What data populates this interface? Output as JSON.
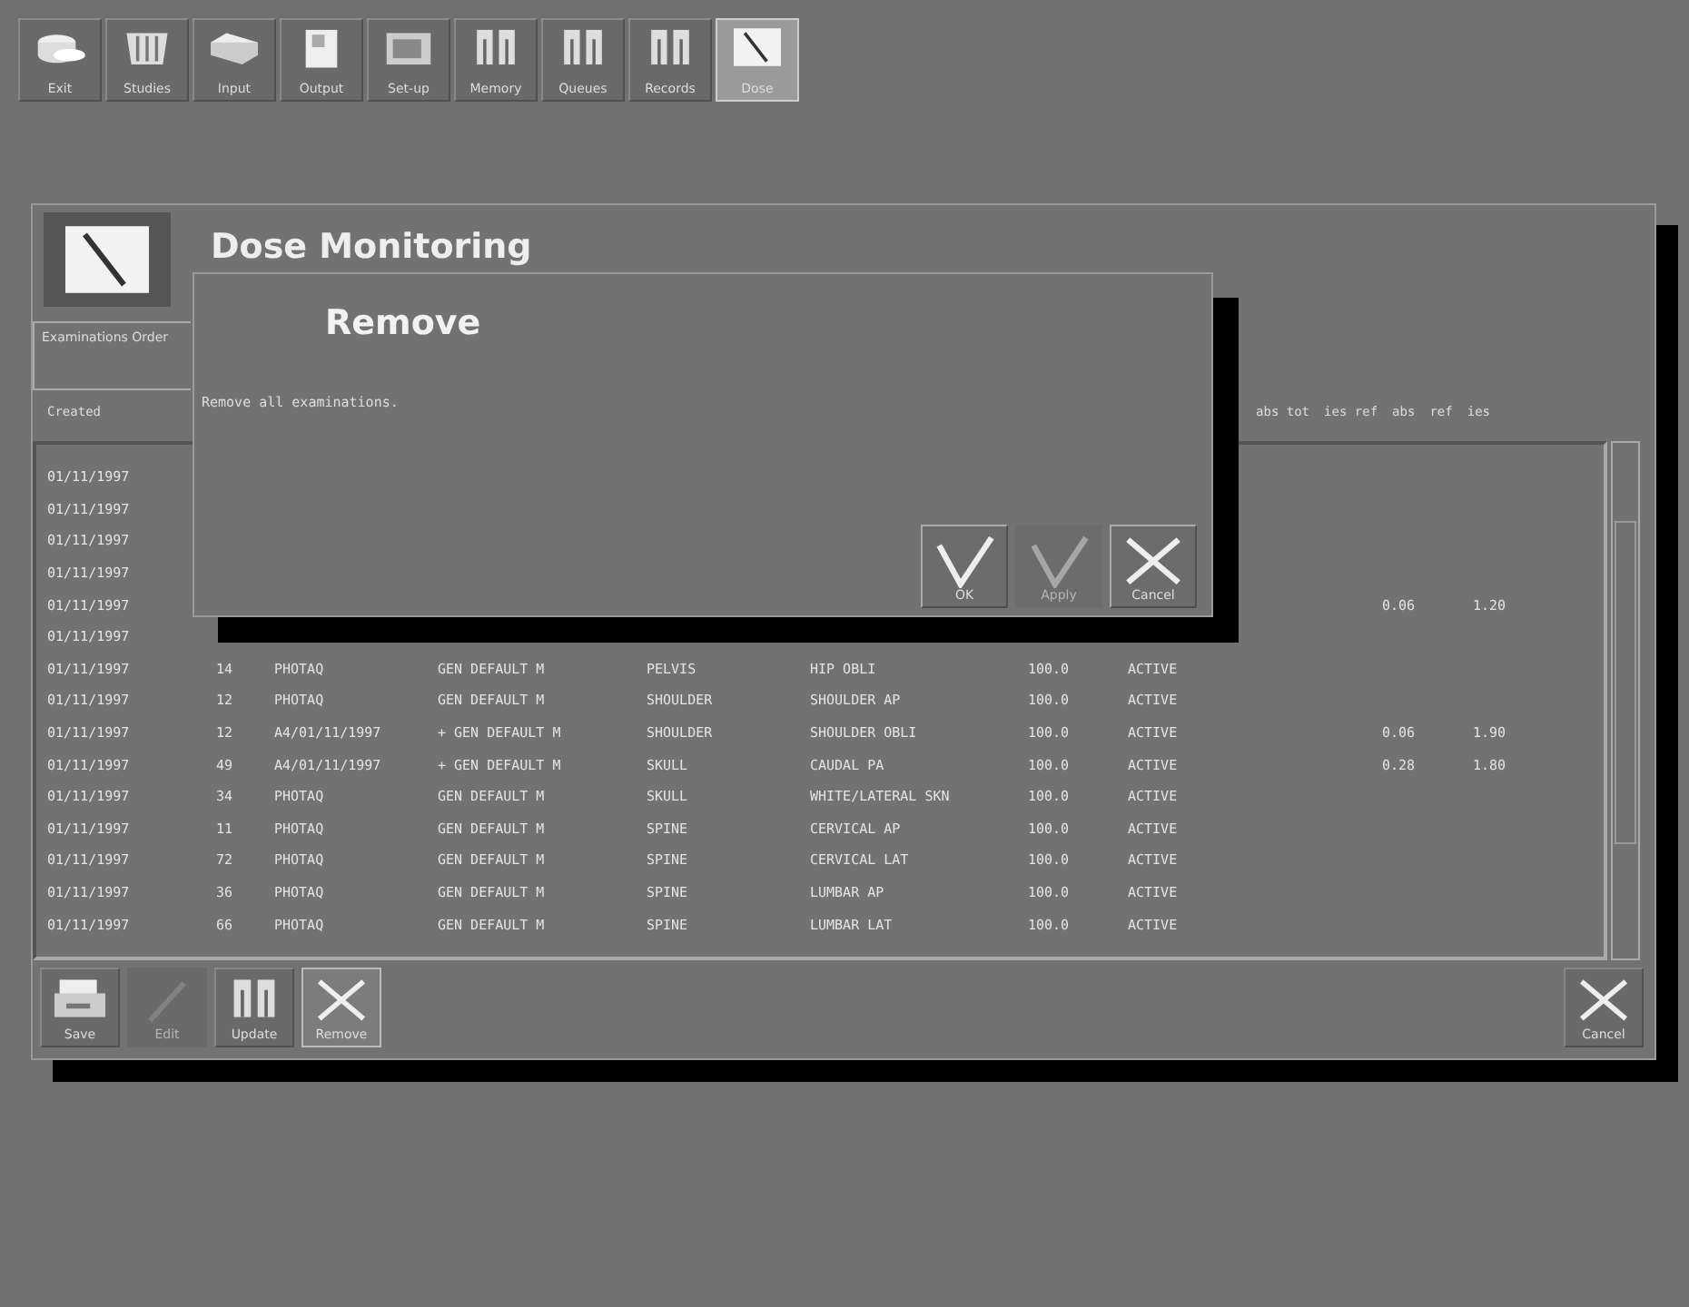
{
  "toolbar": [
    {
      "label": "Exit",
      "selected": false
    },
    {
      "label": "Studies",
      "selected": false
    },
    {
      "label": "Input",
      "selected": false
    },
    {
      "label": "Output",
      "selected": false
    },
    {
      "label": "Set-up",
      "selected": false
    },
    {
      "label": "Memory",
      "selected": false
    },
    {
      "label": "Queues",
      "selected": false
    },
    {
      "label": "Records",
      "selected": false
    },
    {
      "label": "Dose",
      "selected": true
    }
  ],
  "panel": {
    "title": "Dose Monitoring",
    "tab": "Examinations Order",
    "columns": [
      "Created",
      "abs tot",
      "ies ref",
      "abs",
      "ref",
      "ies"
    ],
    "rows": [
      {
        "created": "01/11/1997"
      },
      {
        "created": "01/11/1997"
      },
      {
        "created": "01/11/1997"
      },
      {
        "created": "01/11/1997"
      },
      {
        "created": "01/11/1997",
        "column_9": "0.06",
        "column_10": "1.20"
      },
      {
        "created": "01/11/1997"
      },
      {
        "created": "01/11/1997",
        "column_2": "14",
        "column_3": "PHOTAQ",
        "column_4": "GEN DEFAULT M",
        "column_5": "PELVIS",
        "column_6": "HIP OBLI",
        "column_7": "100.0",
        "column_8": "ACTIVE"
      },
      {
        "created": "01/11/1997",
        "column_2": "12",
        "column_3": "PHOTAQ",
        "column_4": "GEN DEFAULT M",
        "column_5": "SHOULDER",
        "column_6": "SHOULDER AP",
        "column_7": "100.0",
        "column_8": "ACTIVE"
      },
      {
        "created": "01/11/1997",
        "column_2": "12",
        "column_3": "A4/01/11/1997",
        "column_4": "+ GEN DEFAULT M",
        "column_5": "SHOULDER",
        "column_6": "SHOULDER OBLI",
        "column_7": "100.0",
        "column_8": "ACTIVE",
        "column_9": "0.06",
        "column_10": "1.90"
      },
      {
        "created": "01/11/1997",
        "column_2": "49",
        "column_3": "A4/01/11/1997",
        "column_4": "+ GEN DEFAULT M",
        "column_5": "SKULL",
        "column_6": "CAUDAL PA",
        "column_7": "100.0",
        "column_8": "ACTIVE",
        "column_9": "0.28",
        "column_10": "1.80"
      },
      {
        "created": "01/11/1997",
        "column_2": "34",
        "column_3": "PHOTAQ",
        "column_4": "GEN DEFAULT M",
        "column_5": "SKULL",
        "column_6": "WHITE/LATERAL SKN",
        "column_7": "100.0",
        "column_8": "ACTIVE"
      },
      {
        "created": "01/11/1997",
        "column_2": "11",
        "column_3": "PHOTAQ",
        "column_4": "GEN DEFAULT M",
        "column_5": "SPINE",
        "column_6": "CERVICAL AP",
        "column_7": "100.0",
        "column_8": "ACTIVE"
      },
      {
        "created": "01/11/1997",
        "column_2": "72",
        "column_3": "PHOTAQ",
        "column_4": "GEN DEFAULT M",
        "column_5": "SPINE",
        "column_6": "CERVICAL LAT",
        "column_7": "100.0",
        "column_8": "ACTIVE"
      },
      {
        "created": "01/11/1997",
        "column_2": "36",
        "column_3": "PHOTAQ",
        "column_4": "GEN DEFAULT M",
        "column_5": "SPINE",
        "column_6": "LUMBAR AP",
        "column_7": "100.0",
        "column_8": "ACTIVE"
      },
      {
        "created": "01/11/1997",
        "column_2": "66",
        "column_3": "PHOTAQ",
        "column_4": "GEN DEFAULT M",
        "column_5": "SPINE",
        "column_6": "LUMBAR LAT",
        "column_7": "100.0",
        "column_8": "ACTIVE"
      }
    ],
    "actions": [
      {
        "label": "Save",
        "disabled": false,
        "selected": false
      },
      {
        "label": "Edit",
        "disabled": true,
        "selected": false
      },
      {
        "label": "Update",
        "disabled": false,
        "selected": false
      },
      {
        "label": "Remove",
        "disabled": false,
        "selected": true
      }
    ],
    "cancel": {
      "label": "Cancel"
    }
  },
  "dialog": {
    "title": "Remove",
    "message": "Remove all examinations.",
    "buttons": [
      {
        "label": "OK",
        "disabled": false
      },
      {
        "label": "Apply",
        "disabled": true
      },
      {
        "label": "Cancel",
        "disabled": false
      }
    ]
  }
}
